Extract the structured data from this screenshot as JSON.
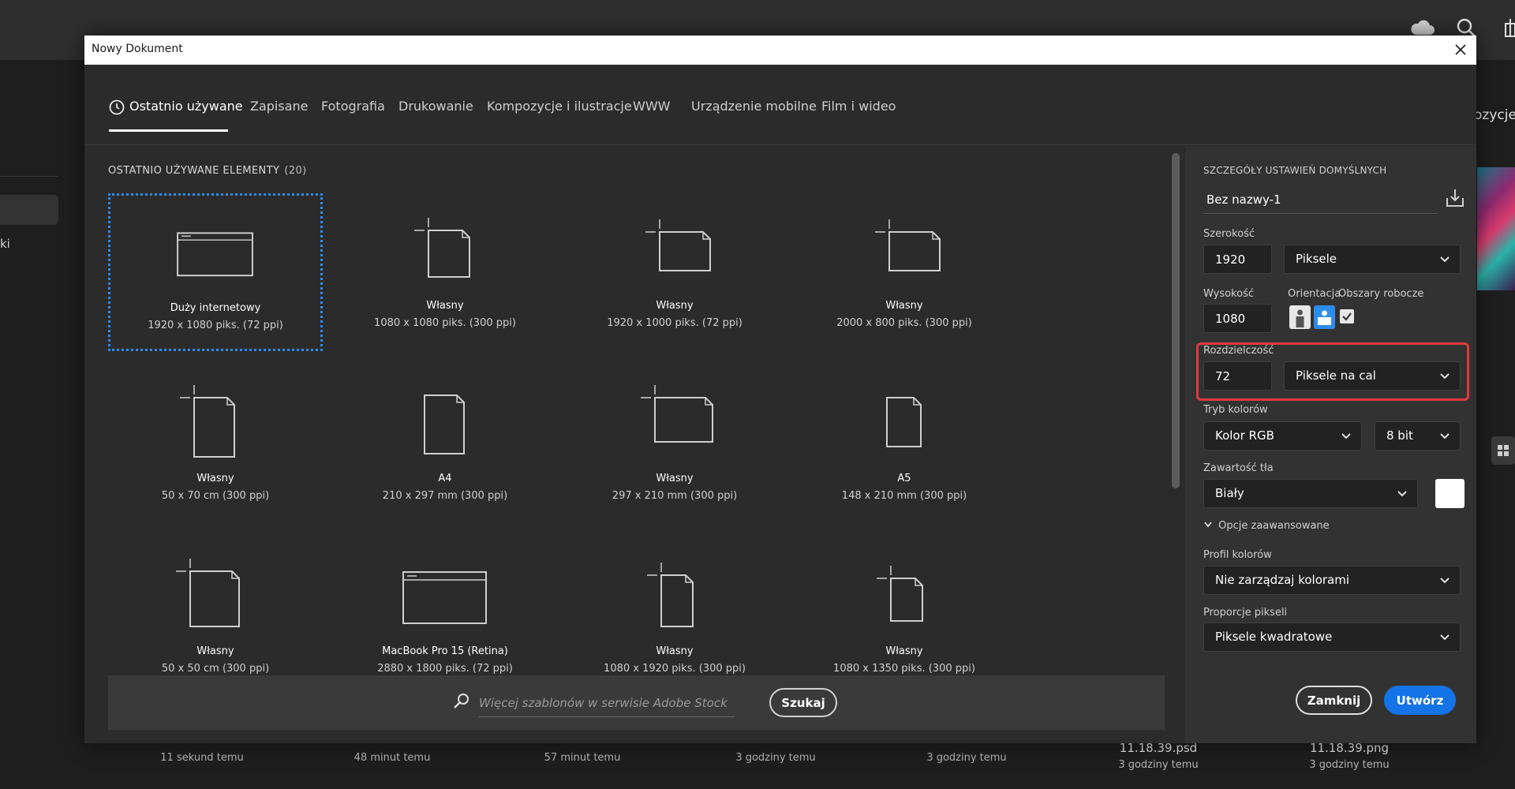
{
  "dialog": {
    "title": "Nowy Dokument"
  },
  "tabs": [
    {
      "label": "Ostatnio używane",
      "active": true
    },
    {
      "label": "Zapisane"
    },
    {
      "label": "Fotografia"
    },
    {
      "label": "Drukowanie"
    },
    {
      "label": "Kompozycje i ilustracje"
    },
    {
      "label": "WWW"
    },
    {
      "label": "Urządzenie mobilne"
    },
    {
      "label": "Film i wideo"
    }
  ],
  "recent": {
    "label": "OSTATNIO UŻYWANE ELEMENTY",
    "count": "(20)",
    "items": [
      {
        "name": "Duży internetowy",
        "dims": "1920 x 1080 piks. (72 ppi)",
        "icon": "web-document-icon",
        "selected": true
      },
      {
        "name": "Własny",
        "dims": "1080 x 1080 piks. (300 ppi)",
        "icon": "custom-document-icon"
      },
      {
        "name": "Własny",
        "dims": "1920 x 1000 piks. (72 ppi)",
        "icon": "custom-document-icon"
      },
      {
        "name": "Własny",
        "dims": "2000 x 800 piks. (300 ppi)",
        "icon": "custom-document-icon"
      },
      {
        "name": "Własny",
        "dims": "50 x 70 cm (300 ppi)",
        "icon": "custom-document-icon"
      },
      {
        "name": "A4",
        "dims": "210 x 297 mm (300 ppi)",
        "icon": "document-icon"
      },
      {
        "name": "Własny",
        "dims": "297 x 210 mm (300 ppi)",
        "icon": "custom-document-icon"
      },
      {
        "name": "A5",
        "dims": "148 x 210 mm (300 ppi)",
        "icon": "document-icon"
      },
      {
        "name": "Własny",
        "dims": "50 x 50 cm (300 ppi)",
        "icon": "custom-document-icon"
      },
      {
        "name": "MacBook Pro 15 (Retina)",
        "dims": "2880 x 1800 piks. (72 ppi)",
        "icon": "web-document-icon"
      },
      {
        "name": "Własny",
        "dims": "1080 x 1920 piks. (300 ppi)",
        "icon": "custom-document-icon"
      },
      {
        "name": "Własny",
        "dims": "1080 x 1350 piks. (300 ppi)",
        "icon": "custom-document-icon"
      }
    ]
  },
  "stock": {
    "placeholder": "Więcej szablonów w serwisie Adobe Stock",
    "search_label": "Szukaj"
  },
  "details": {
    "heading": "SZCZEGÓŁY USTAWIEŃ DOMYŚLNYCH",
    "doc_name": "Bez nazwy-1",
    "width_label": "Szerokość",
    "width_value": "1920",
    "width_unit": "Piksele",
    "height_label": "Wysokość",
    "height_value": "1080",
    "orientation_label": "Orientacja",
    "artboards_label": "Obszary robocze",
    "resolution_label": "Rozdzielczość",
    "resolution_value": "72",
    "resolution_unit": "Piksele na cal",
    "color_mode_label": "Tryb kolorów",
    "color_mode": "Kolor RGB",
    "bit_depth": "8 bit",
    "background_label": "Zawartość tła",
    "background": "Biały",
    "advanced_label": "Opcje zaawansowane",
    "color_profile_label": "Profil kolorów",
    "color_profile": "Nie zarządzaj kolorami",
    "pixel_aspect_label": "Proporcje pikseli",
    "pixel_aspect": "Piksele kwadratowe",
    "close_label": "Zamknij",
    "create_label": "Utwórz"
  },
  "background_app": {
    "right_text": "ozycje",
    "left_text": "ki",
    "files": [
      {
        "name": "",
        "time": "11 sekund temu"
      },
      {
        "name": "",
        "time": "48 minut temu"
      },
      {
        "name": "",
        "time": "57 minut temu"
      },
      {
        "name": "",
        "time": "3 godziny temu"
      },
      {
        "name": "",
        "time": "3 godziny temu"
      },
      {
        "name": "11.18.39.psd",
        "time": "3 godziny temu"
      },
      {
        "name": "11.18.39.png",
        "time": "3 godziny temu"
      }
    ]
  },
  "colors": {
    "accent": "#1473e6",
    "selection": "#2d8ceb",
    "highlight": "#e0393e"
  }
}
